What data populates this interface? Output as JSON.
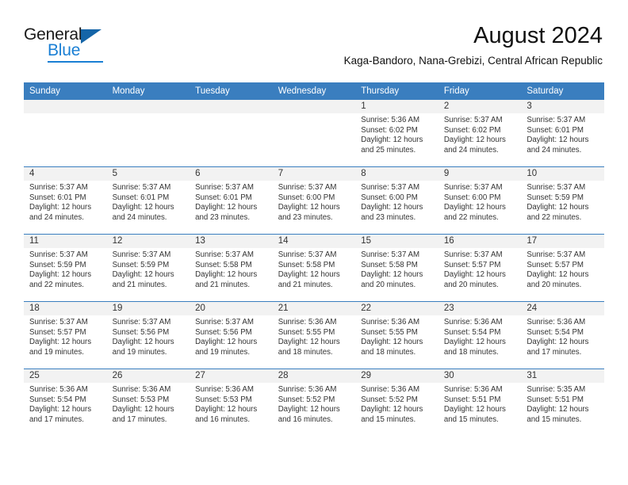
{
  "brand": {
    "name_top": "General",
    "name_bottom": "Blue",
    "accent_color": "#1a7fd4",
    "triangle_color": "#1565a8"
  },
  "header": {
    "title": "August 2024",
    "location": "Kaga-Bandoro, Nana-Grebizi, Central African Republic"
  },
  "theme": {
    "header_bar": "#3a7ebf",
    "date_band": "#f2f2f2",
    "grid_line": "#3a7ebf",
    "text": "#333333"
  },
  "weekdays": [
    "Sunday",
    "Monday",
    "Tuesday",
    "Wednesday",
    "Thursday",
    "Friday",
    "Saturday"
  ],
  "labels": {
    "sunrise_prefix": "Sunrise:",
    "sunset_prefix": "Sunset:",
    "daylight_prefix": "Daylight:"
  },
  "weeks": [
    [
      {
        "empty": true
      },
      {
        "empty": true
      },
      {
        "empty": true
      },
      {
        "empty": true
      },
      {
        "day": "1",
        "sunrise": "Sunrise: 5:36 AM",
        "sunset": "Sunset: 6:02 PM",
        "daylight_a": "Daylight: 12 hours",
        "daylight_b": "and 25 minutes."
      },
      {
        "day": "2",
        "sunrise": "Sunrise: 5:37 AM",
        "sunset": "Sunset: 6:02 PM",
        "daylight_a": "Daylight: 12 hours",
        "daylight_b": "and 24 minutes."
      },
      {
        "day": "3",
        "sunrise": "Sunrise: 5:37 AM",
        "sunset": "Sunset: 6:01 PM",
        "daylight_a": "Daylight: 12 hours",
        "daylight_b": "and 24 minutes."
      }
    ],
    [
      {
        "day": "4",
        "sunrise": "Sunrise: 5:37 AM",
        "sunset": "Sunset: 6:01 PM",
        "daylight_a": "Daylight: 12 hours",
        "daylight_b": "and 24 minutes."
      },
      {
        "day": "5",
        "sunrise": "Sunrise: 5:37 AM",
        "sunset": "Sunset: 6:01 PM",
        "daylight_a": "Daylight: 12 hours",
        "daylight_b": "and 24 minutes."
      },
      {
        "day": "6",
        "sunrise": "Sunrise: 5:37 AM",
        "sunset": "Sunset: 6:01 PM",
        "daylight_a": "Daylight: 12 hours",
        "daylight_b": "and 23 minutes."
      },
      {
        "day": "7",
        "sunrise": "Sunrise: 5:37 AM",
        "sunset": "Sunset: 6:00 PM",
        "daylight_a": "Daylight: 12 hours",
        "daylight_b": "and 23 minutes."
      },
      {
        "day": "8",
        "sunrise": "Sunrise: 5:37 AM",
        "sunset": "Sunset: 6:00 PM",
        "daylight_a": "Daylight: 12 hours",
        "daylight_b": "and 23 minutes."
      },
      {
        "day": "9",
        "sunrise": "Sunrise: 5:37 AM",
        "sunset": "Sunset: 6:00 PM",
        "daylight_a": "Daylight: 12 hours",
        "daylight_b": "and 22 minutes."
      },
      {
        "day": "10",
        "sunrise": "Sunrise: 5:37 AM",
        "sunset": "Sunset: 5:59 PM",
        "daylight_a": "Daylight: 12 hours",
        "daylight_b": "and 22 minutes."
      }
    ],
    [
      {
        "day": "11",
        "sunrise": "Sunrise: 5:37 AM",
        "sunset": "Sunset: 5:59 PM",
        "daylight_a": "Daylight: 12 hours",
        "daylight_b": "and 22 minutes."
      },
      {
        "day": "12",
        "sunrise": "Sunrise: 5:37 AM",
        "sunset": "Sunset: 5:59 PM",
        "daylight_a": "Daylight: 12 hours",
        "daylight_b": "and 21 minutes."
      },
      {
        "day": "13",
        "sunrise": "Sunrise: 5:37 AM",
        "sunset": "Sunset: 5:58 PM",
        "daylight_a": "Daylight: 12 hours",
        "daylight_b": "and 21 minutes."
      },
      {
        "day": "14",
        "sunrise": "Sunrise: 5:37 AM",
        "sunset": "Sunset: 5:58 PM",
        "daylight_a": "Daylight: 12 hours",
        "daylight_b": "and 21 minutes."
      },
      {
        "day": "15",
        "sunrise": "Sunrise: 5:37 AM",
        "sunset": "Sunset: 5:58 PM",
        "daylight_a": "Daylight: 12 hours",
        "daylight_b": "and 20 minutes."
      },
      {
        "day": "16",
        "sunrise": "Sunrise: 5:37 AM",
        "sunset": "Sunset: 5:57 PM",
        "daylight_a": "Daylight: 12 hours",
        "daylight_b": "and 20 minutes."
      },
      {
        "day": "17",
        "sunrise": "Sunrise: 5:37 AM",
        "sunset": "Sunset: 5:57 PM",
        "daylight_a": "Daylight: 12 hours",
        "daylight_b": "and 20 minutes."
      }
    ],
    [
      {
        "day": "18",
        "sunrise": "Sunrise: 5:37 AM",
        "sunset": "Sunset: 5:57 PM",
        "daylight_a": "Daylight: 12 hours",
        "daylight_b": "and 19 minutes."
      },
      {
        "day": "19",
        "sunrise": "Sunrise: 5:37 AM",
        "sunset": "Sunset: 5:56 PM",
        "daylight_a": "Daylight: 12 hours",
        "daylight_b": "and 19 minutes."
      },
      {
        "day": "20",
        "sunrise": "Sunrise: 5:37 AM",
        "sunset": "Sunset: 5:56 PM",
        "daylight_a": "Daylight: 12 hours",
        "daylight_b": "and 19 minutes."
      },
      {
        "day": "21",
        "sunrise": "Sunrise: 5:36 AM",
        "sunset": "Sunset: 5:55 PM",
        "daylight_a": "Daylight: 12 hours",
        "daylight_b": "and 18 minutes."
      },
      {
        "day": "22",
        "sunrise": "Sunrise: 5:36 AM",
        "sunset": "Sunset: 5:55 PM",
        "daylight_a": "Daylight: 12 hours",
        "daylight_b": "and 18 minutes."
      },
      {
        "day": "23",
        "sunrise": "Sunrise: 5:36 AM",
        "sunset": "Sunset: 5:54 PM",
        "daylight_a": "Daylight: 12 hours",
        "daylight_b": "and 18 minutes."
      },
      {
        "day": "24",
        "sunrise": "Sunrise: 5:36 AM",
        "sunset": "Sunset: 5:54 PM",
        "daylight_a": "Daylight: 12 hours",
        "daylight_b": "and 17 minutes."
      }
    ],
    [
      {
        "day": "25",
        "sunrise": "Sunrise: 5:36 AM",
        "sunset": "Sunset: 5:54 PM",
        "daylight_a": "Daylight: 12 hours",
        "daylight_b": "and 17 minutes."
      },
      {
        "day": "26",
        "sunrise": "Sunrise: 5:36 AM",
        "sunset": "Sunset: 5:53 PM",
        "daylight_a": "Daylight: 12 hours",
        "daylight_b": "and 17 minutes."
      },
      {
        "day": "27",
        "sunrise": "Sunrise: 5:36 AM",
        "sunset": "Sunset: 5:53 PM",
        "daylight_a": "Daylight: 12 hours",
        "daylight_b": "and 16 minutes."
      },
      {
        "day": "28",
        "sunrise": "Sunrise: 5:36 AM",
        "sunset": "Sunset: 5:52 PM",
        "daylight_a": "Daylight: 12 hours",
        "daylight_b": "and 16 minutes."
      },
      {
        "day": "29",
        "sunrise": "Sunrise: 5:36 AM",
        "sunset": "Sunset: 5:52 PM",
        "daylight_a": "Daylight: 12 hours",
        "daylight_b": "and 15 minutes."
      },
      {
        "day": "30",
        "sunrise": "Sunrise: 5:36 AM",
        "sunset": "Sunset: 5:51 PM",
        "daylight_a": "Daylight: 12 hours",
        "daylight_b": "and 15 minutes."
      },
      {
        "day": "31",
        "sunrise": "Sunrise: 5:35 AM",
        "sunset": "Sunset: 5:51 PM",
        "daylight_a": "Daylight: 12 hours",
        "daylight_b": "and 15 minutes."
      }
    ]
  ]
}
